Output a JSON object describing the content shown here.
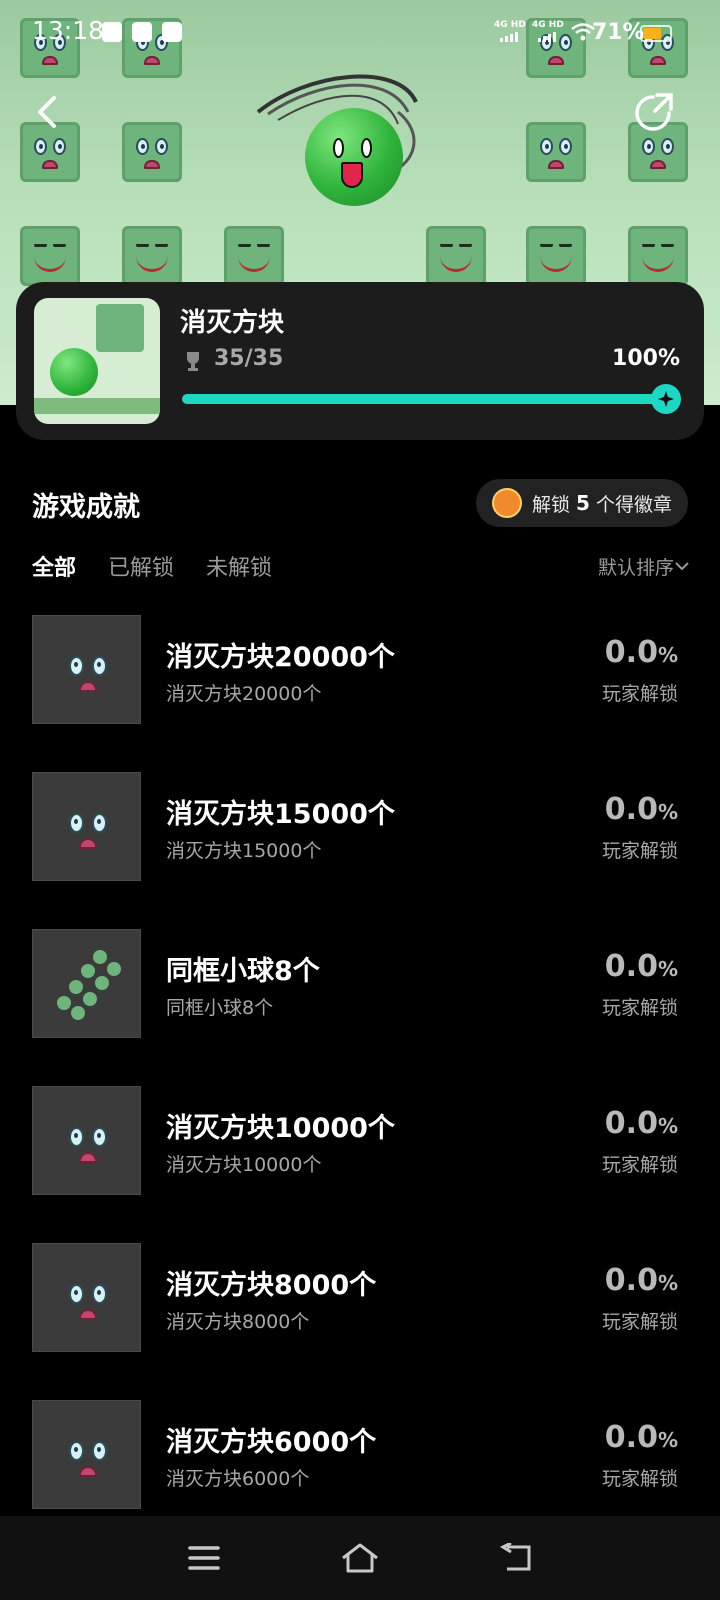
{
  "status_bar": {
    "time": "13:18",
    "network_1": "4G HD",
    "network_2": "4G HD",
    "battery": "71%",
    "battery_level": 0.71,
    "battery_color": "#f6b21b"
  },
  "header": {
    "back_icon": "chevron-left-icon",
    "share_icon": "share-icon"
  },
  "game": {
    "title": "消灭方块",
    "progress_text": "35/35",
    "progress_percent_label": "100%",
    "progress": 1.0,
    "accent_color": "#1ed6c2"
  },
  "achievements": {
    "section_title": "游戏成就",
    "badge_prefix": "解锁",
    "badge_count": "5",
    "badge_suffix": "个得徽章",
    "tabs": [
      {
        "label": "全部",
        "active": true
      },
      {
        "label": "已解锁",
        "active": false
      },
      {
        "label": "未解锁",
        "active": false
      }
    ],
    "sort_label": "默认排序",
    "items": [
      {
        "title": "消灭方块20000个",
        "subtitle": "消灭方块20000个",
        "rate": "0.0",
        "rate_unit": "%",
        "rate_label": "玩家解锁",
        "icon": "block-face-icon"
      },
      {
        "title": "消灭方块15000个",
        "subtitle": "消灭方块15000个",
        "rate": "0.0",
        "rate_unit": "%",
        "rate_label": "玩家解锁",
        "icon": "block-face-icon"
      },
      {
        "title": "同框小球8个",
        "subtitle": "同框小球8个",
        "rate": "0.0",
        "rate_unit": "%",
        "rate_label": "玩家解锁",
        "icon": "balls-icon"
      },
      {
        "title": "消灭方块10000个",
        "subtitle": "消灭方块10000个",
        "rate": "0.0",
        "rate_unit": "%",
        "rate_label": "玩家解锁",
        "icon": "block-face-icon"
      },
      {
        "title": "消灭方块8000个",
        "subtitle": "消灭方块8000个",
        "rate": "0.0",
        "rate_unit": "%",
        "rate_label": "玩家解锁",
        "icon": "block-face-icon"
      },
      {
        "title": "消灭方块6000个",
        "subtitle": "消灭方块6000个",
        "rate": "0.0",
        "rate_unit": "%",
        "rate_label": "玩家解锁",
        "icon": "block-face-icon"
      }
    ]
  },
  "navbar": {
    "menu_icon": "menu-icon",
    "home_icon": "home-icon",
    "back_icon": "back-icon"
  }
}
